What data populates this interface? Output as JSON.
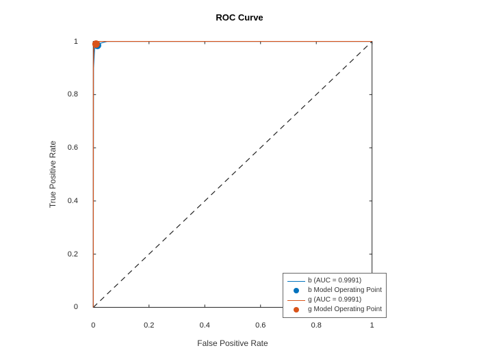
{
  "chart_data": {
    "type": "line",
    "title": "ROC Curve",
    "xlabel": "False Positive Rate",
    "ylabel": "True Positive Rate",
    "xlim": [
      -0.04,
      1.04
    ],
    "ylim": [
      -0.04,
      1.04
    ],
    "xticks": [
      0,
      0.2,
      0.4,
      0.6,
      0.8,
      1
    ],
    "yticks": [
      0,
      0.2,
      0.4,
      0.6,
      0.8,
      1
    ],
    "series": [
      {
        "name": "b (AUC = 0.9991)",
        "color": "#0072BD",
        "x": [
          0,
          0.001,
          0.005,
          0.015,
          0.05,
          1
        ],
        "y": [
          0,
          0.9,
          0.975,
          0.99,
          1.0,
          1.0
        ]
      },
      {
        "name": "g (AUC = 0.9991)",
        "color": "#D95319",
        "x": [
          0,
          0.0005,
          0.002,
          0.004,
          0.02,
          1
        ],
        "y": [
          0,
          0.92,
          0.985,
          0.995,
          1.0,
          1.0
        ]
      }
    ],
    "operating_points": [
      {
        "name": "b Model Operating Point",
        "color": "#0072BD",
        "x": 0.015,
        "y": 0.985
      },
      {
        "name": "g Model Operating Point",
        "color": "#D95319",
        "x": 0.01,
        "y": 0.99
      }
    ],
    "diagonal": {
      "x": [
        0,
        1
      ],
      "y": [
        0,
        1
      ],
      "style": "dashed",
      "color": "#222"
    },
    "legend": [
      {
        "kind": "line",
        "color": "#0072BD",
        "label": "b (AUC = 0.9991)"
      },
      {
        "kind": "dot",
        "color": "#0072BD",
        "label": "b Model Operating Point"
      },
      {
        "kind": "line",
        "color": "#D95319",
        "label": "g (AUC = 0.9991)"
      },
      {
        "kind": "dot",
        "color": "#D95319",
        "label": "g Model Operating Point"
      }
    ]
  }
}
